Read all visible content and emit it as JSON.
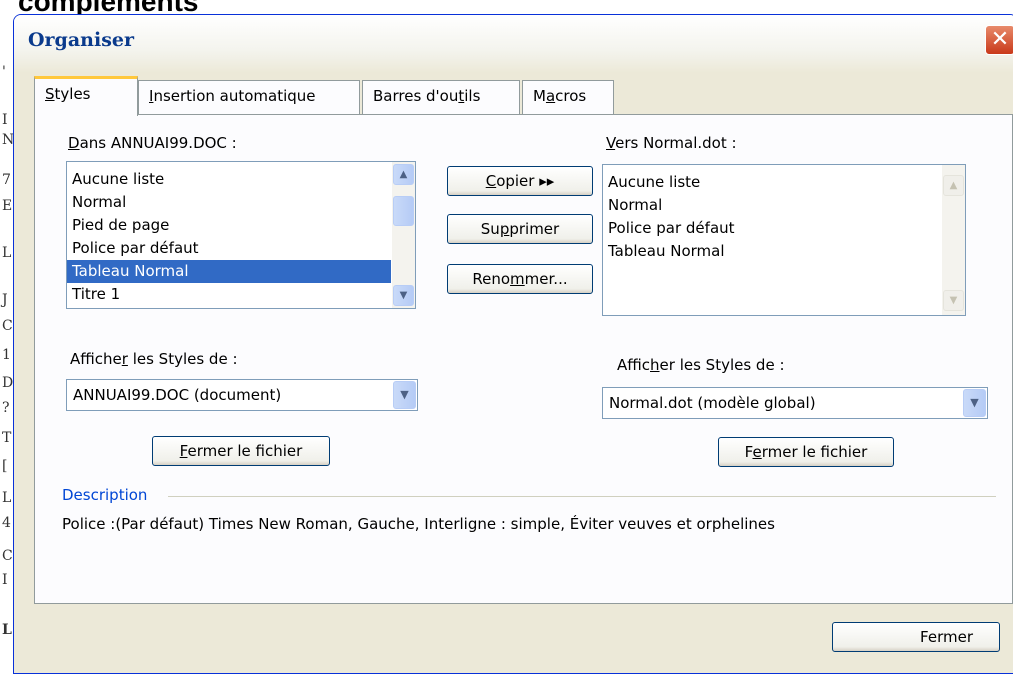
{
  "background": {
    "heading_fragment": "compléments",
    "left_margin_chars": [
      "'",
      "I",
      "N",
      "7",
      "E",
      "L",
      "J",
      "C",
      "1",
      "D",
      "?",
      "T",
      "[",
      "L",
      "4",
      "C",
      "I",
      "L"
    ]
  },
  "dialog": {
    "title": "Organiser",
    "close_symbol": "✕"
  },
  "tabs": [
    {
      "pre": "",
      "u": "S",
      "post": "tyles"
    },
    {
      "pre": "",
      "u": "I",
      "post": "nsertion automatique"
    },
    {
      "pre": "Barres d'ou",
      "u": "t",
      "post": "ils"
    },
    {
      "pre": "M",
      "u": "a",
      "post": "cros"
    }
  ],
  "left": {
    "label": {
      "pre": "",
      "u": "D",
      "post": "ans ANNUAI99.DOC :"
    },
    "items": [
      "Aucune liste",
      "Normal",
      "Pied de page",
      "Police par défaut",
      "Tableau Normal",
      "Titre 1"
    ],
    "selected_index": 4,
    "show_label": {
      "pre": "Affiche",
      "u": "r",
      "post": " les Styles de :"
    },
    "combo_value": "ANNUAI99.DOC (document)",
    "close_file": {
      "pre": "",
      "u": "F",
      "post": "ermer le fichier"
    }
  },
  "right": {
    "label": {
      "pre": "",
      "u": "V",
      "post": "ers Normal.dot :"
    },
    "items": [
      "Aucune liste",
      "Normal",
      "Police par défaut",
      "Tableau Normal"
    ],
    "show_label": {
      "pre": "Affic",
      "u": "h",
      "post": "er les Styles de :"
    },
    "combo_value": "Normal.dot (modèle global)",
    "close_file": {
      "pre": "F",
      "u": "e",
      "post": "rmer le fichier"
    }
  },
  "middle": {
    "copy": {
      "pre": "",
      "u": "C",
      "post": "opier ▸▸"
    },
    "delete": {
      "pre": "Su",
      "u": "p",
      "post": "primer"
    },
    "rename": {
      "pre": "Reno",
      "u": "m",
      "post": "mer..."
    }
  },
  "description": {
    "legend": "Description",
    "text": "Police :(Par défaut) Times New Roman, Gauche, Interligne : simple, Éviter veuves et orphelines"
  },
  "footer": {
    "close_label": "Fermer"
  },
  "icons": {
    "scroll_up": "▲",
    "scroll_down": "▼",
    "combo_arrow": "▼"
  }
}
